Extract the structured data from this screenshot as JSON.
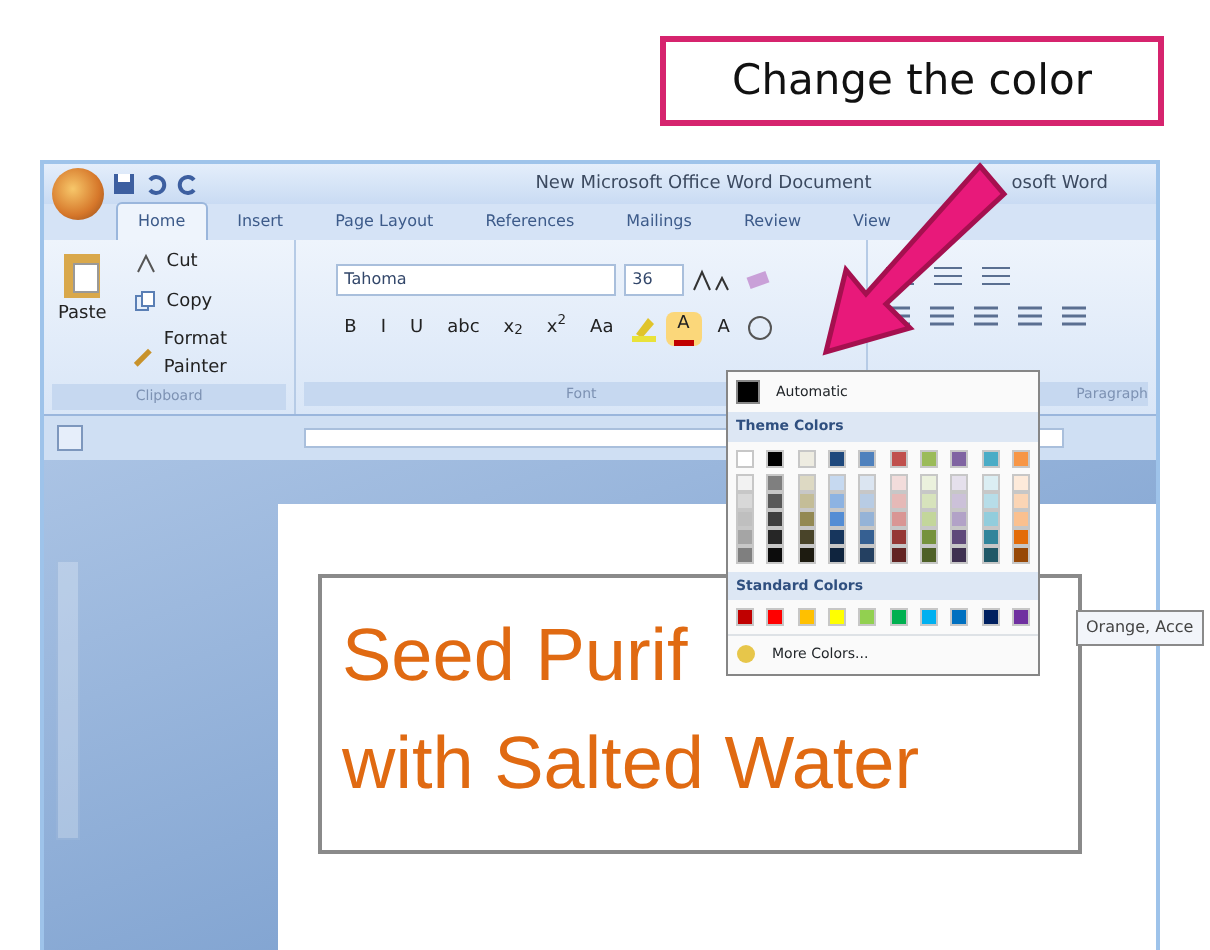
{
  "callout": {
    "text": "Change the color"
  },
  "window": {
    "title_left": "New Microsoft Office Word Document",
    "title_right": "osoft Word"
  },
  "tabs": [
    {
      "label": "Home",
      "selected": true
    },
    {
      "label": "Insert",
      "selected": false
    },
    {
      "label": "Page Layout",
      "selected": false
    },
    {
      "label": "References",
      "selected": false
    },
    {
      "label": "Mailings",
      "selected": false
    },
    {
      "label": "Review",
      "selected": false
    },
    {
      "label": "View",
      "selected": false
    }
  ],
  "clipboard": {
    "paste": "Paste",
    "items": [
      "Cut",
      "Copy",
      "Format Painter"
    ],
    "group_label": "Clipboard"
  },
  "font": {
    "name": "Tahoma",
    "size": "36",
    "buttons": [
      "B",
      "I",
      "U",
      "abc",
      "x$_{2}$",
      "x$^{2}$",
      "Aa"
    ],
    "color_button": "A",
    "shading_button": "A",
    "group_label": "Font"
  },
  "paragraph": {
    "group_label": "Paragraph"
  },
  "color_menu": {
    "automatic": "Automatic",
    "theme_title": "Theme Colors",
    "theme_rows": [
      [
        {
          "color": "#ffffff"
        },
        {
          "color": "#000000"
        },
        {
          "color": "#eeece1"
        },
        {
          "color": "#1f497d"
        },
        {
          "color": "#4f81bd"
        },
        {
          "color": "#c0504d"
        },
        {
          "color": "#9bbb59"
        },
        {
          "color": "#8064a2"
        },
        {
          "color": "#4bacc6"
        },
        {
          "color": "#f79646"
        }
      ],
      [
        {
          "color": "#f2f2f2"
        },
        {
          "color": "#7f7f7f"
        },
        {
          "color": "#ddd9c3"
        },
        {
          "color": "#c6d9f0"
        },
        {
          "color": "#dbe5f1"
        },
        {
          "color": "#f2dcdb"
        },
        {
          "color": "#ebf1dd"
        },
        {
          "color": "#e5e0ec"
        },
        {
          "color": "#dbeef3"
        },
        {
          "color": "#fdeada"
        }
      ],
      [
        {
          "color": "#d8d8d8"
        },
        {
          "color": "#595959"
        },
        {
          "color": "#c4bd97"
        },
        {
          "color": "#8db3e2"
        },
        {
          "color": "#b8cce4"
        },
        {
          "color": "#e5b9b7"
        },
        {
          "color": "#d7e3bc"
        },
        {
          "color": "#ccc1d9"
        },
        {
          "color": "#b7dde8"
        },
        {
          "color": "#fbd5b5"
        }
      ],
      [
        {
          "color": "#bfbfbf"
        },
        {
          "color": "#3f3f3f"
        },
        {
          "color": "#938953"
        },
        {
          "color": "#548dd4"
        },
        {
          "color": "#95b3d7"
        },
        {
          "color": "#d99694"
        },
        {
          "color": "#c3d69b"
        },
        {
          "color": "#b2a2c7"
        },
        {
          "color": "#92cddc"
        },
        {
          "color": "#fac08f"
        }
      ],
      [
        {
          "color": "#a5a5a5"
        },
        {
          "color": "#262626"
        },
        {
          "color": "#494429"
        },
        {
          "color": "#17365d"
        },
        {
          "color": "#366092"
        },
        {
          "color": "#953734"
        },
        {
          "color": "#76923c"
        },
        {
          "color": "#5f497a"
        },
        {
          "color": "#31859b"
        },
        {
          "color": "#e36c09"
        }
      ],
      [
        {
          "color": "#7f7f7f"
        },
        {
          "color": "#0c0c0c"
        },
        {
          "color": "#1d1b10"
        },
        {
          "color": "#0f243e"
        },
        {
          "color": "#244061"
        },
        {
          "color": "#632423"
        },
        {
          "color": "#4f6128"
        },
        {
          "color": "#3f3151"
        },
        {
          "color": "#205867"
        },
        {
          "color": "#974806"
        }
      ]
    ],
    "standard_title": "Standard Colors",
    "standard": [
      {
        "color": "#c00000"
      },
      {
        "color": "#ff0000"
      },
      {
        "color": "#ffc000"
      },
      {
        "color": "#ffff00"
      },
      {
        "color": "#92d050"
      },
      {
        "color": "#00b050"
      },
      {
        "color": "#00b0f0"
      },
      {
        "color": "#0070c0"
      },
      {
        "color": "#002060"
      },
      {
        "color": "#7030a0"
      }
    ],
    "more": "More Colors..."
  },
  "tooltip": {
    "text": "Orange, Acce"
  },
  "document": {
    "lines": [
      "Seed Purif",
      "with Salted Water"
    ]
  }
}
